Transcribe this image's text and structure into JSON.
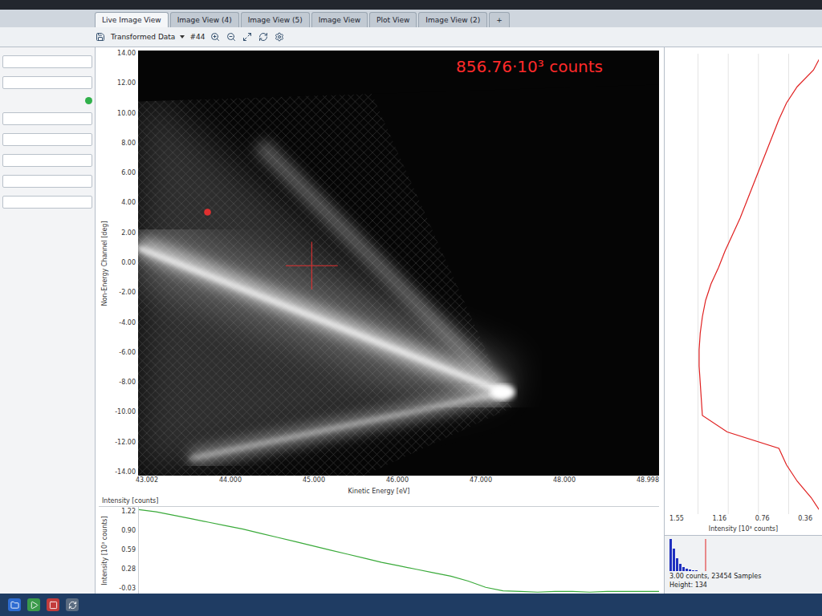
{
  "tabs": [
    {
      "label": "Live Image View",
      "selected": true
    },
    {
      "label": "Image View (4)",
      "selected": false
    },
    {
      "label": "Image View (5)",
      "selected": false
    },
    {
      "label": "Image View",
      "selected": false
    },
    {
      "label": "Plot View",
      "selected": false
    },
    {
      "label": "Image View (2)",
      "selected": false
    }
  ],
  "add_tab": "+",
  "toolbar": {
    "source": "Transformed Data",
    "frame": "#44"
  },
  "image": {
    "counts": "856.76·10³ counts",
    "y_axis": {
      "label": "Non-Energy Channel [deg]",
      "ticks": [
        "14.00",
        "12.00",
        "10.00",
        "8.00",
        "6.00",
        "4.00",
        "2.00",
        "0.00",
        "-2.00",
        "-4.00",
        "-6.00",
        "-8.00",
        "-10.00",
        "-12.00",
        "-14.00"
      ]
    },
    "x_axis": {
      "label": "Kinetic Energy [eV]",
      "ticks": [
        "43.002",
        "44.000",
        "45.000",
        "46.000",
        "47.000",
        "48.000",
        "48.998"
      ]
    }
  },
  "edc": {
    "title": "Intensity [counts]",
    "y_label": "Intensity [10³ counts]",
    "y_ticks": [
      "1.22",
      "0.90",
      "0.59",
      "0.28",
      "-0.03"
    ],
    "values": [
      1.18,
      1.15,
      1.1,
      1.05,
      1.0,
      0.95,
      0.9,
      0.84,
      0.78,
      0.72,
      0.66,
      0.6,
      0.54,
      0.48,
      0.42,
      0.37,
      0.32,
      0.27,
      0.22,
      0.15,
      0.06,
      0.01,
      0.0,
      -0.01,
      0.0,
      0.0,
      -0.01,
      0.0,
      0.0,
      0.0,
      0.0
    ]
  },
  "profile": {
    "x_ticks": [
      "1.55",
      "1.16",
      "0.76",
      "0.36"
    ],
    "label": "Intensity [10³ counts]",
    "values": [
      0.22,
      0.3,
      0.45,
      0.55,
      0.62,
      0.68,
      0.74,
      0.8,
      0.86,
      0.92,
      0.98,
      1.05,
      1.12,
      1.18,
      1.25,
      1.3,
      1.33,
      1.35,
      1.36,
      1.36,
      1.35,
      1.34,
      1.33,
      1.1,
      0.62,
      0.55,
      0.45,
      0.32,
      0.22
    ]
  },
  "histogram": {
    "bars": [
      40,
      28,
      16,
      9,
      5,
      3,
      2,
      1,
      1
    ],
    "summary": "3.00 counts, 23454 Samples",
    "height": "Height: 134"
  }
}
